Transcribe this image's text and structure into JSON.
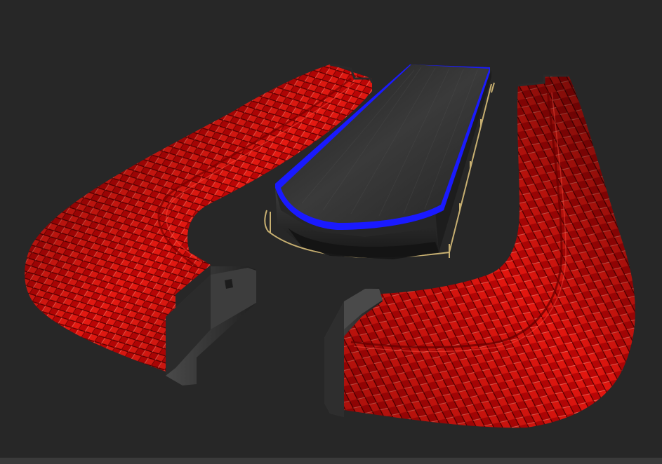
{
  "viewport": {
    "background": "#272727",
    "bottom_bar_color": "#3a3a3a"
  },
  "scene": {
    "sofa_upholstery_color": "#d40808",
    "sofa_pattern": "quilted-diamond",
    "wood_color": "#2c2c2c",
    "table_edge_color": "#1a1aff",
    "rail_color": "#c8b071",
    "objects": [
      "left-curved-sofa",
      "right-curved-sofa",
      "bar-table",
      "brass-rail"
    ]
  }
}
